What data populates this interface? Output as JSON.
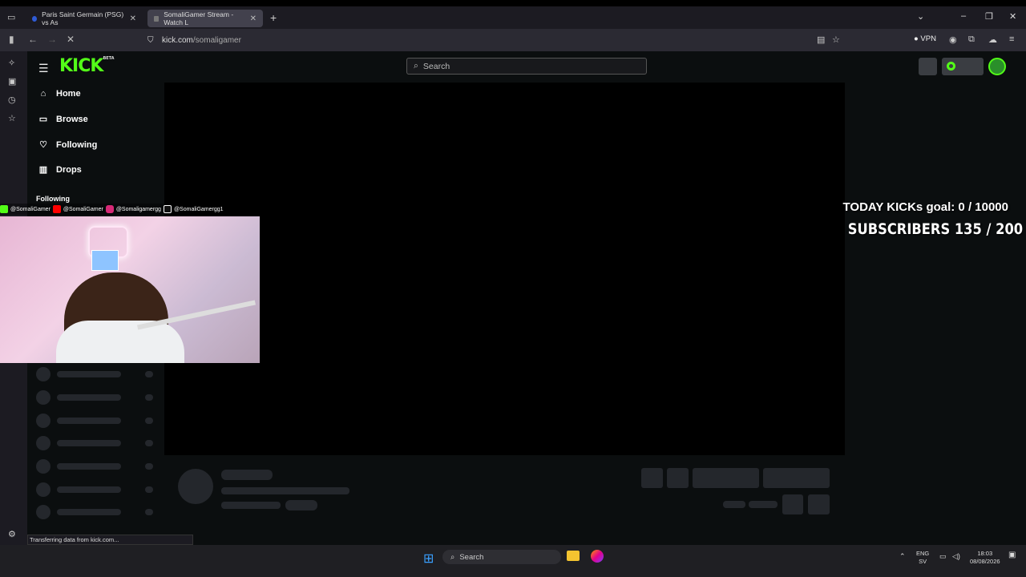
{
  "browser": {
    "tabs": [
      {
        "label": "Paris Saint Germain (PSG) vs As"
      },
      {
        "label": "SomaliGamer Stream - Watch L"
      }
    ],
    "url_host": "kick.com",
    "url_path": "/somaligamer",
    "vpn_label": "VPN",
    "status_text": "Transferring data from kick.com..."
  },
  "kick": {
    "logo": "KICK",
    "logo_badge": "BETA",
    "search_placeholder": "Search",
    "nav": [
      {
        "label": "Home",
        "icon": "home-icon"
      },
      {
        "label": "Browse",
        "icon": "browse-icon"
      },
      {
        "label": "Following",
        "icon": "heart-icon"
      },
      {
        "label": "Drops",
        "icon": "drops-icon"
      }
    ],
    "following_section": "Following"
  },
  "stream_overlay": {
    "kicks_goal": "TODAY KICKs goal: 0 / 10000",
    "subscribers": "SUBSCRIBERS 135 / 200",
    "socials": [
      "@SomaliGamer",
      "@SomaliGamer",
      "@Somaligamergg",
      "@SomaliGamergg1"
    ]
  },
  "taskbar": {
    "search_label": "Search",
    "lang_top": "ENG",
    "lang_bottom": "SV",
    "time": "18:03",
    "date": "08/08/2026"
  },
  "colors": {
    "accent": "#53fc18",
    "background": "#0b0e0f"
  }
}
